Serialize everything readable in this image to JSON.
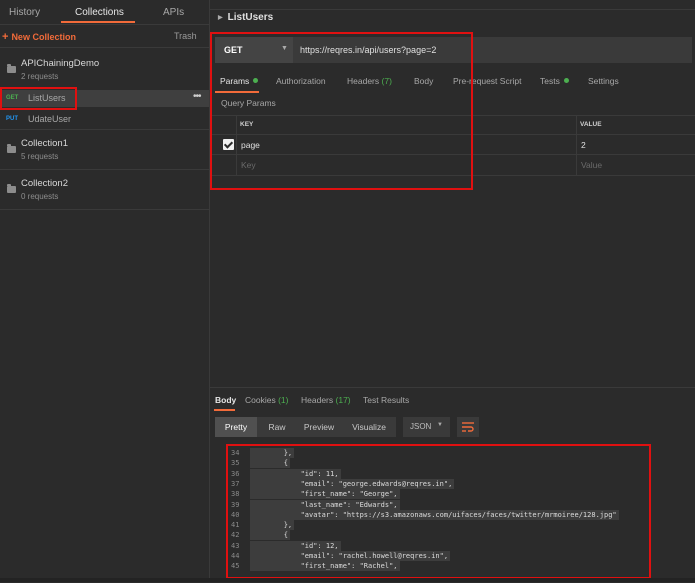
{
  "sidebar": {
    "tabs": [
      "History",
      "Collections",
      "APIs"
    ],
    "new_collection": "New Collection",
    "trash": "Trash",
    "collections": [
      {
        "name": "APIChainingDemo",
        "count": "2 requests"
      },
      {
        "name": "Collection1",
        "count": "5 requests"
      },
      {
        "name": "Collection2",
        "count": "0 requests"
      }
    ],
    "requests": [
      {
        "method": "GET",
        "name": "ListUsers",
        "method_color": "#4caf50"
      },
      {
        "method": "PUT",
        "name": "UdateUser",
        "method_color": "#2196f3"
      }
    ],
    "more": "•••"
  },
  "request": {
    "title": "ListUsers",
    "method": "GET",
    "url": "https://reqres.in/api/users?page=2",
    "tabs": [
      "Params",
      "Authorization",
      "Headers",
      "Body",
      "Pre-request Script",
      "Tests",
      "Settings"
    ],
    "headers_count": "(7)",
    "query_params_title": "Query Params",
    "table_header": {
      "key": "KEY",
      "value": "VALUE"
    },
    "params": [
      {
        "key": "page",
        "value": "2",
        "checked": true
      }
    ],
    "placeholder": {
      "key": "Key",
      "value": "Value"
    }
  },
  "response": {
    "tabs": [
      "Body",
      "Cookies",
      "Headers",
      "Test Results"
    ],
    "cookies_count": "(1)",
    "headers_count": "(17)",
    "views": [
      "Pretty",
      "Raw",
      "Preview",
      "Visualize"
    ],
    "format": "JSON",
    "lines": [
      {
        "n": "34",
        "t": "        },"
      },
      {
        "n": "35",
        "t": "        {"
      },
      {
        "n": "36",
        "t": "            \"id\": 11,"
      },
      {
        "n": "37",
        "t": "            \"email\": \"george.edwards@reqres.in\","
      },
      {
        "n": "38",
        "t": "            \"first_name\": \"George\","
      },
      {
        "n": "39",
        "t": "            \"last_name\": \"Edwards\","
      },
      {
        "n": "40",
        "t": "            \"avatar\": \"https://s3.amazonaws.com/uifaces/faces/twitter/mrmoiree/128.jpg\""
      },
      {
        "n": "41",
        "t": "        },"
      },
      {
        "n": "42",
        "t": "        {"
      },
      {
        "n": "43",
        "t": "            \"id\": 12,"
      },
      {
        "n": "44",
        "t": "            \"email\": \"rachel.howell@reqres.in\","
      },
      {
        "n": "45",
        "t": "            \"first_name\": \"Rachel\","
      }
    ]
  },
  "colors": {
    "accent": "#f26b3a",
    "highlight_box": "#e01010",
    "status_green": "#4caf50"
  }
}
